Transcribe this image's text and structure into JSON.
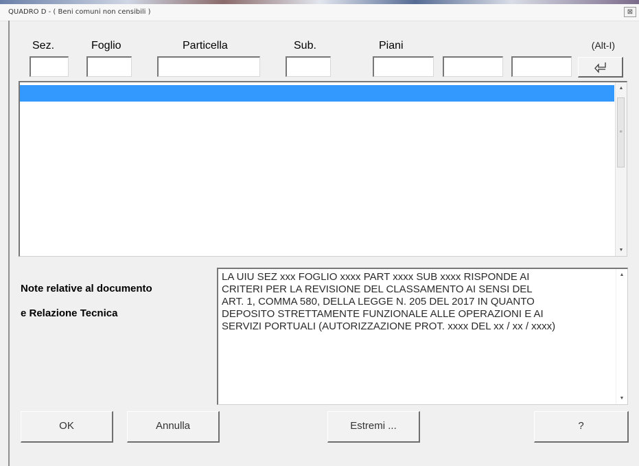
{
  "window": {
    "title": "QUADRO D  -  ( Beni comuni non censibili )",
    "close_glyph": "⊠"
  },
  "columns": {
    "sez": "Sez.",
    "foglio": "Foglio",
    "particella": "Particella",
    "sub": "Sub.",
    "piani": "Piani",
    "shortcut": "(Alt-I)"
  },
  "fields": {
    "sez": "",
    "foglio": "",
    "particella": "",
    "sub": "",
    "piano1": "",
    "piano2": "",
    "piano3": ""
  },
  "notes": {
    "label_line1": "Note relative al documento",
    "label_line2": "e Relazione Tecnica",
    "text": "LA UIU SEZ xxx FOGLIO xxxx PART xxxx SUB xxxx RISPONDE AI\nCRITERI PER LA REVISIONE DEL CLASSAMENTO AI SENSI DEL\nART. 1, COMMA 580, DELLA LEGGE N. 205 DEL 2017 IN QUANTO\nDEPOSITO STRETTAMENTE FUNZIONALE ALLE OPERAZIONI E AI\nSERVIZI PORTUALI (AUTORIZZAZIONE PROT. xxxx DEL xx / xx / xxxx)"
  },
  "buttons": {
    "ok": "OK",
    "annulla": "Annulla",
    "estremi": "Estremi ...",
    "help": "?"
  },
  "icons": {
    "insert": "insert-arrow-icon",
    "scroll_up": "▲",
    "scroll_down": "▼",
    "scroll_grip": "≡"
  },
  "colors": {
    "selection": "#3399ff"
  }
}
